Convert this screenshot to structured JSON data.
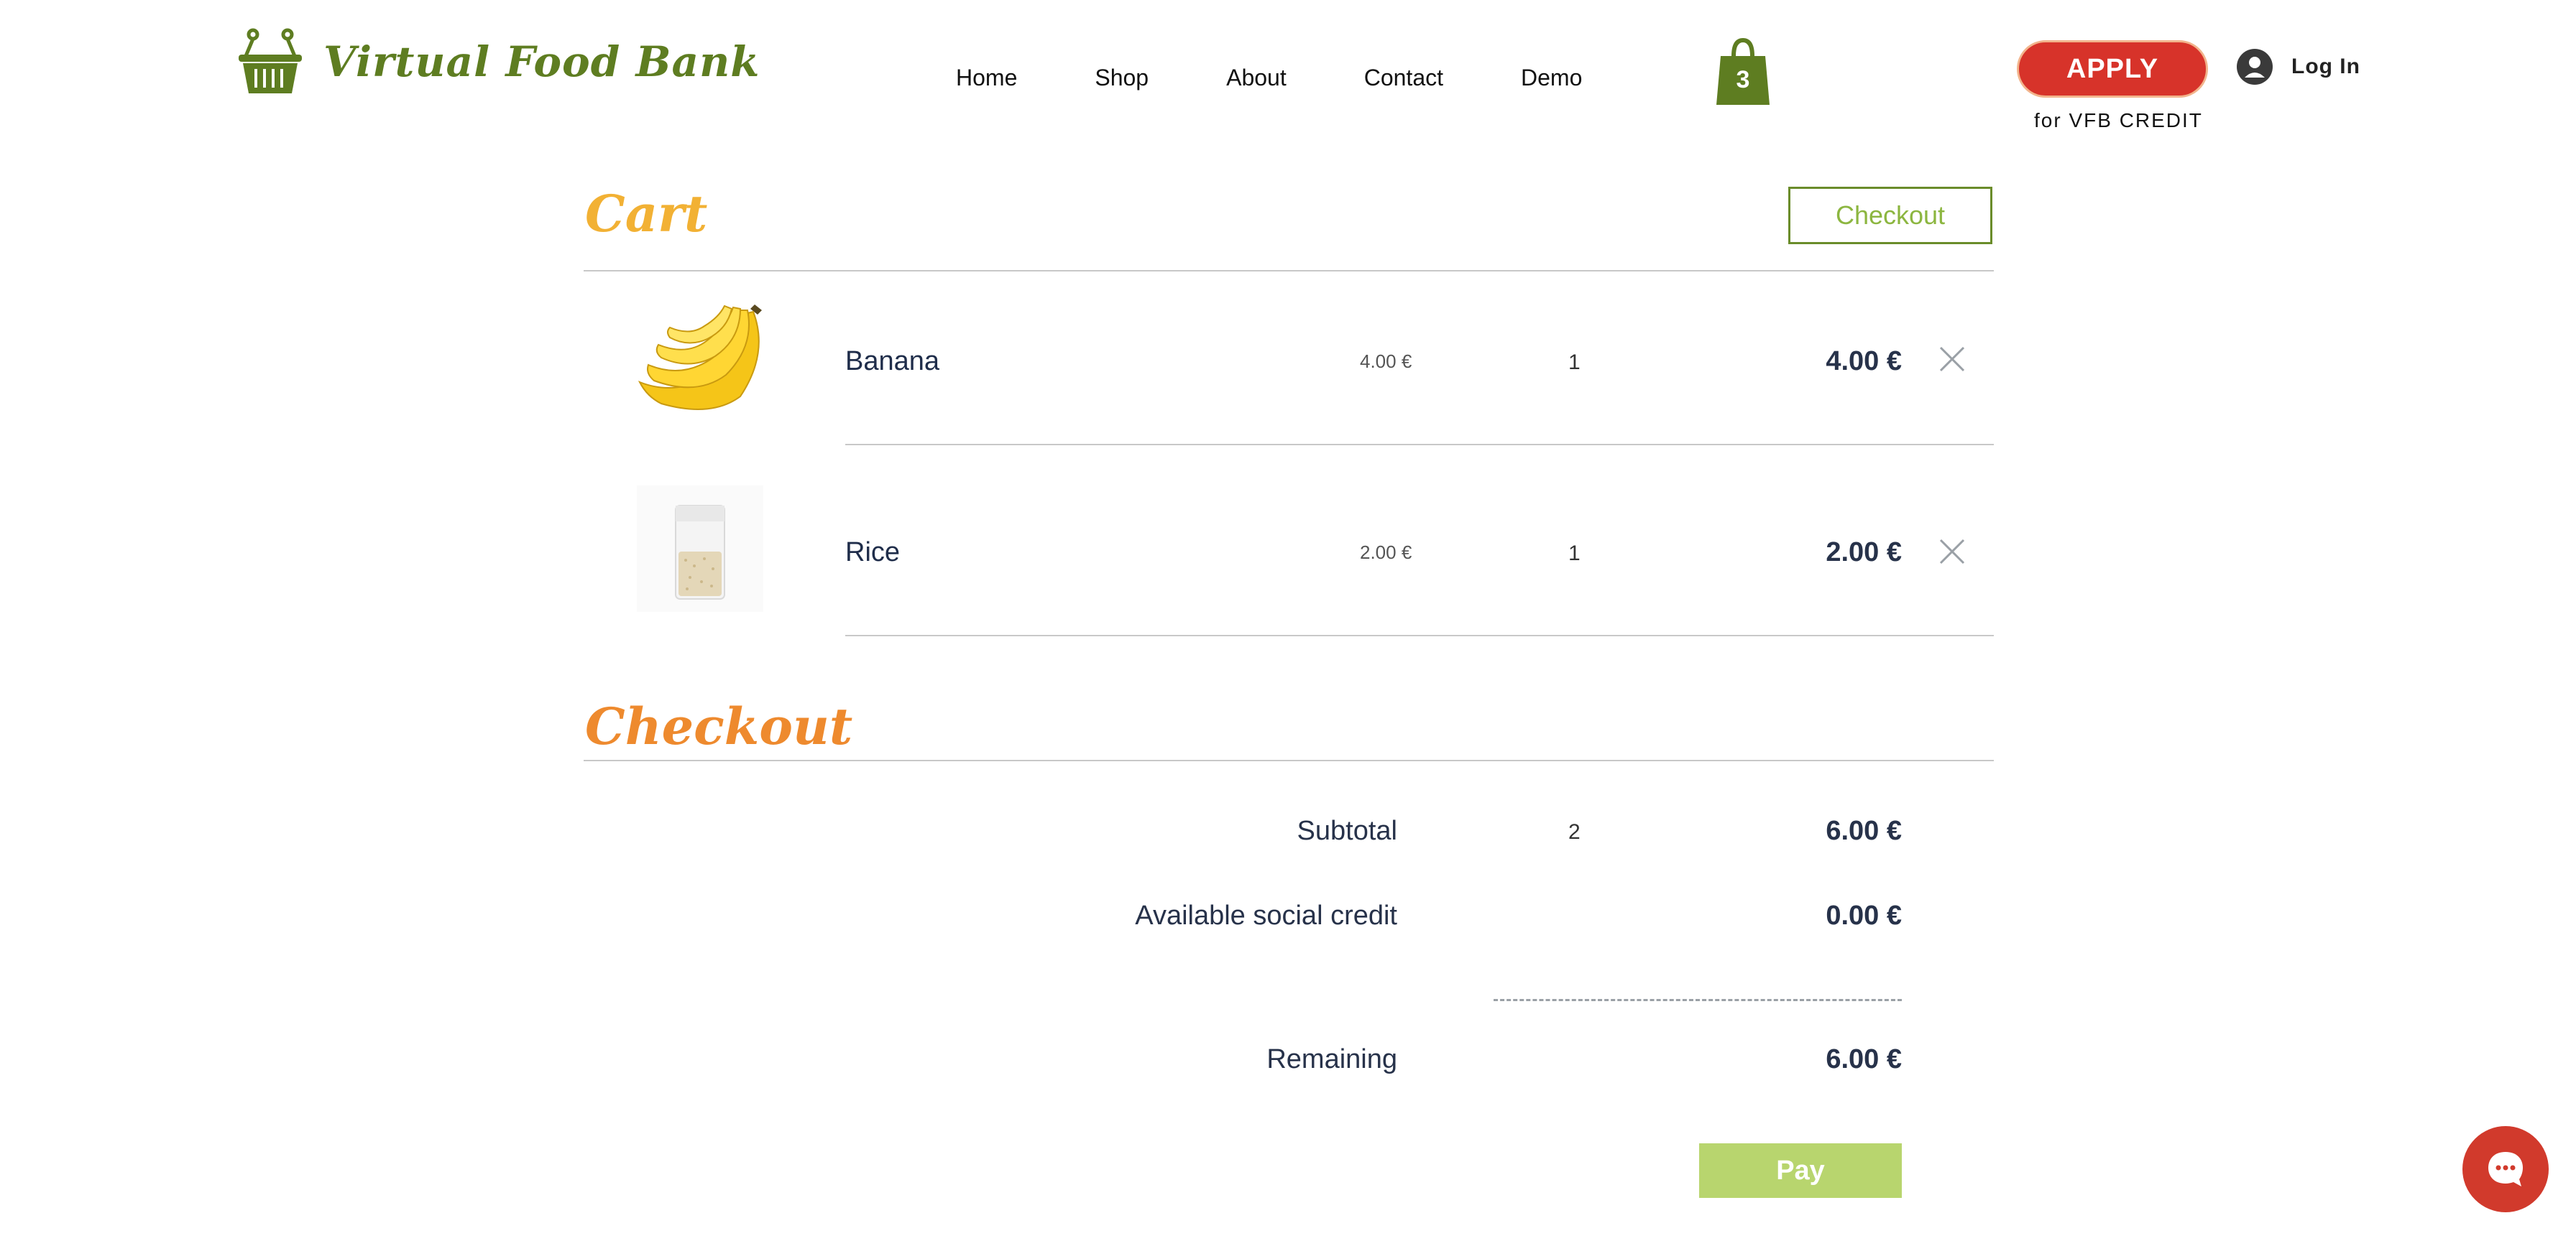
{
  "header": {
    "brand": "Virtual Food Bank",
    "nav": [
      "Home",
      "Shop",
      "About",
      "Contact",
      "Demo"
    ],
    "cart_count": "3",
    "apply_label": "APPLY",
    "apply_subtext": "for VFB CREDIT",
    "login_label": "Log In"
  },
  "cart": {
    "title": "Cart",
    "checkout_button": "Checkout",
    "items": [
      {
        "name": "Banana",
        "unit_price": "4.00 €",
        "quantity": "1",
        "total": "4.00 €",
        "image": "banana-image"
      },
      {
        "name": "Rice",
        "unit_price": "2.00 €",
        "quantity": "1",
        "total": "2.00 €",
        "image": "rice-bag-image"
      }
    ]
  },
  "checkout": {
    "title": "Checkout",
    "subtotal_label": "Subtotal",
    "subtotal_qty": "2",
    "subtotal_value": "6.00 €",
    "credit_label": "Available social credit",
    "credit_value": "0.00 €",
    "remaining_label": "Remaining",
    "remaining_value": "6.00 €",
    "pay_label": "Pay"
  },
  "colors": {
    "brand_green": "#5e7d21",
    "apply_red": "#d7332a",
    "cart_title": "#f2b134",
    "checkout_title": "#ee8a2e",
    "pay_button": "#b8d56e",
    "chat_red": "#d13a2c"
  },
  "icons": [
    "basket-icon",
    "shopping-bag-icon",
    "user-avatar-icon",
    "close-icon",
    "chat-icon"
  ]
}
